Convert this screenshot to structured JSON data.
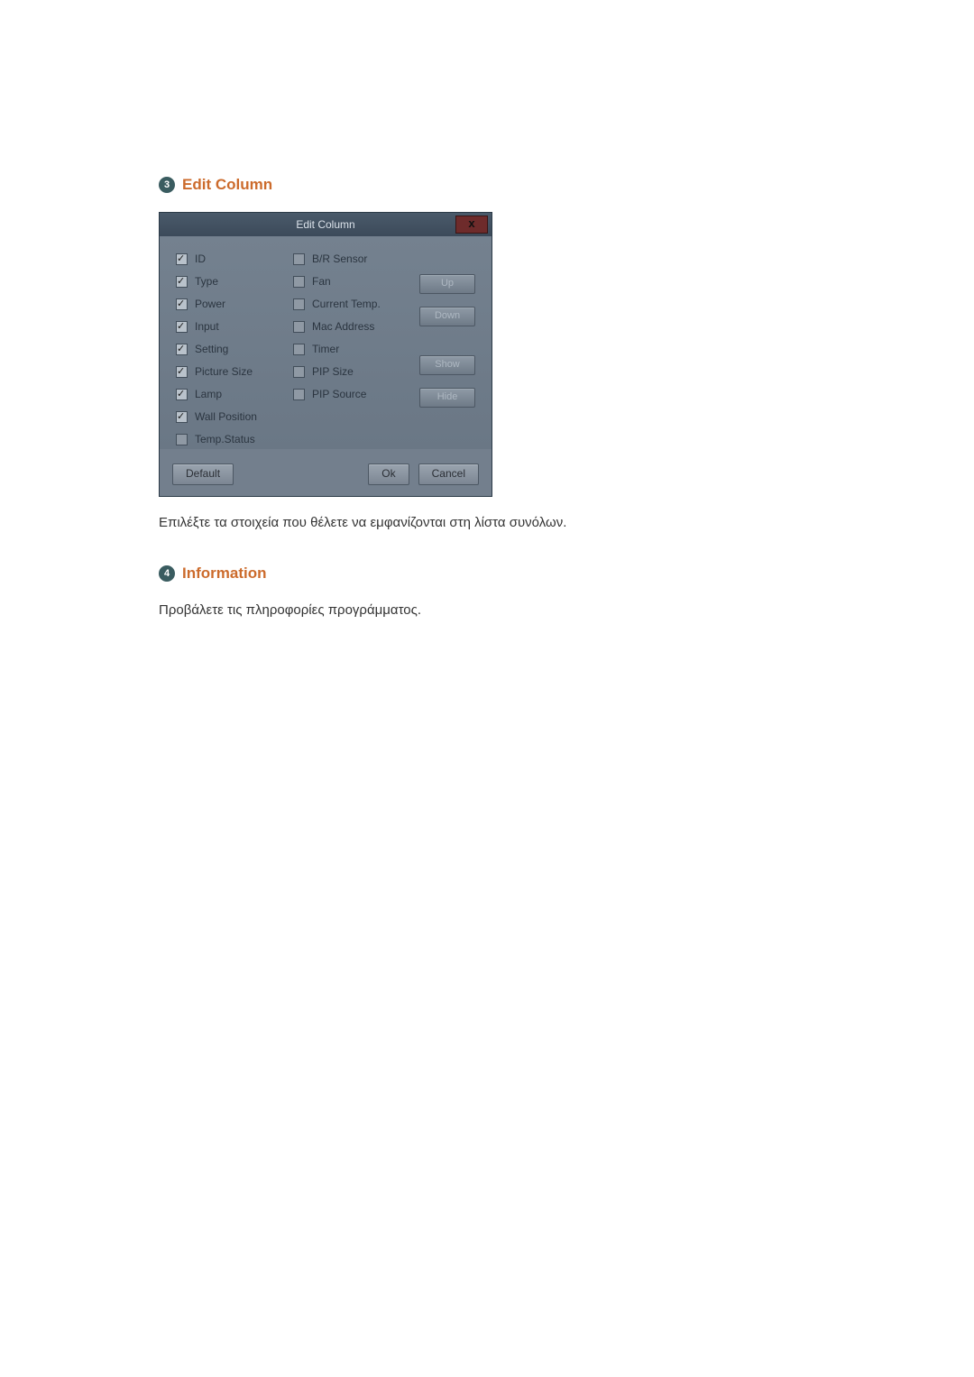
{
  "sections": {
    "edit_column": {
      "badge": "3",
      "title": "Edit Column"
    },
    "information": {
      "badge": "4",
      "title": "Information"
    }
  },
  "captions": {
    "edit_column": "Επιλέξτε τα στοιχεία που θέλετε να εμφανίζονται στη λίστα συνόλων.",
    "information": "Προβάλετε τις πληροφορίες προγράμματος."
  },
  "dialog": {
    "title": "Edit Column",
    "close_glyph": "x",
    "left_items": [
      {
        "label": "ID",
        "checked": true
      },
      {
        "label": "Type",
        "checked": true
      },
      {
        "label": "Power",
        "checked": true
      },
      {
        "label": "Input",
        "checked": true
      },
      {
        "label": "Setting",
        "checked": true
      },
      {
        "label": "Picture Size",
        "checked": true
      },
      {
        "label": "Lamp",
        "checked": true
      },
      {
        "label": "Wall Position",
        "checked": true
      },
      {
        "label": "Temp.Status",
        "checked": false
      }
    ],
    "mid_items": [
      {
        "label": "B/R Sensor",
        "checked": false
      },
      {
        "label": "Fan",
        "checked": false
      },
      {
        "label": "Current Temp.",
        "checked": false
      },
      {
        "label": "Mac Address",
        "checked": false
      },
      {
        "label": "Timer",
        "checked": false
      },
      {
        "label": "PIP Size",
        "checked": false
      },
      {
        "label": "PIP Source",
        "checked": false
      }
    ],
    "side_buttons": {
      "up": "Up",
      "down": "Down",
      "show": "Show",
      "hide": "Hide"
    },
    "footer": {
      "default": "Default",
      "ok": "Ok",
      "cancel": "Cancel"
    }
  }
}
